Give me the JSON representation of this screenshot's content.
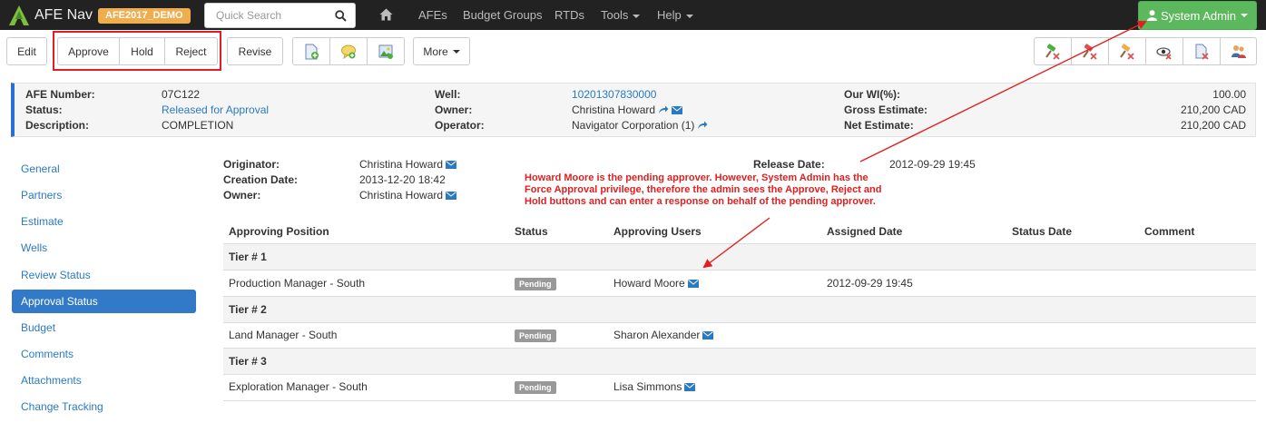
{
  "app": {
    "name": "AFE Nav",
    "environment": "AFE2017_DEMO"
  },
  "nav": {
    "search_placeholder": "Quick Search",
    "links": [
      "AFEs",
      "Budget Groups",
      "RTDs",
      "Tools",
      "Help"
    ],
    "user": "System Admin"
  },
  "toolbar": {
    "edit": "Edit",
    "approve": "Approve",
    "hold": "Hold",
    "reject": "Reject",
    "revise": "Revise",
    "more": "More"
  },
  "header": {
    "afe_number_label": "AFE Number:",
    "afe_number": "07C122",
    "status_label": "Status:",
    "status": "Released for Approval",
    "description_label": "Description:",
    "description": "COMPLETION",
    "well_label": "Well:",
    "well": "10201307830000",
    "owner_label": "Owner:",
    "owner": "Christina Howard",
    "operator_label": "Operator:",
    "operator": "Navigator Corporation (1)",
    "wi_label": "Our WI(%):",
    "wi": "100.00",
    "gross_label": "Gross Estimate:",
    "gross": "210,200 CAD",
    "net_label": "Net Estimate:",
    "net": "210,200 CAD"
  },
  "sidebar": {
    "items": [
      "General",
      "Partners",
      "Estimate",
      "Wells",
      "Review Status",
      "Approval Status",
      "Budget",
      "Comments",
      "Attachments",
      "Change Tracking"
    ],
    "active": "Approval Status"
  },
  "details": {
    "originator_label": "Originator:",
    "originator": "Christina Howard",
    "creation_label": "Creation Date:",
    "creation": "2013-12-20 18:42",
    "owner_label": "Owner:",
    "owner": "Christina Howard",
    "release_label": "Release Date:",
    "release": "2012-09-29 19:45"
  },
  "annotation": {
    "line1": "Howard Moore is the pending approver.  However, System Admin has the",
    "line2": "Force Approval privilege, therefore the admin sees the Approve, Reject and",
    "line3": "Hold buttons and can enter a response on behalf of the pending approver."
  },
  "table": {
    "columns": [
      "Approving Position",
      "Status",
      "Approving Users",
      "Assigned Date",
      "Status Date",
      "Comment"
    ],
    "tiers": [
      {
        "label": "Tier # 1",
        "position": "Production Manager - South",
        "status": "Pending",
        "user": "Howard Moore",
        "assigned": "2012-09-29 19:45"
      },
      {
        "label": "Tier # 2",
        "position": "Land Manager - South",
        "status": "Pending",
        "user": "Sharon Alexander",
        "assigned": ""
      },
      {
        "label": "Tier # 3",
        "position": "Exploration Manager - South",
        "status": "Pending",
        "user": "Lisa Simmons",
        "assigned": ""
      }
    ]
  },
  "colors": {
    "navbar": "#222222",
    "accent": "#3279c7",
    "success": "#5cb85c",
    "env_badge": "#f0ad4e",
    "annotation": "#e02020"
  }
}
